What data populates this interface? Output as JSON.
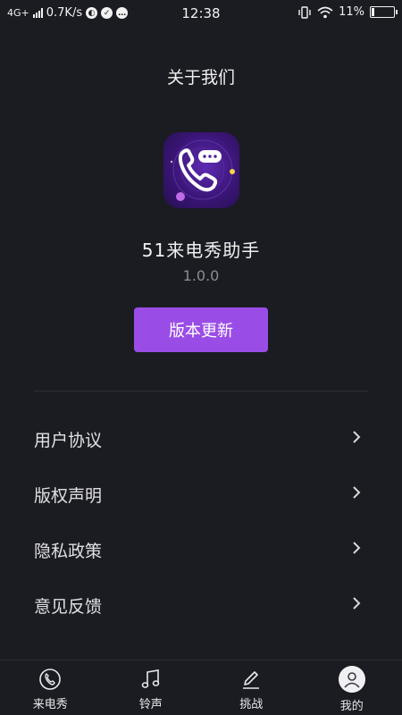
{
  "status_bar": {
    "network": "4G+",
    "speed": "0.7K/s",
    "time": "12:38",
    "battery_percent": "11%",
    "battery_level": 0.11
  },
  "header": {
    "title": "关于我们"
  },
  "app": {
    "name": "51来电秀助手",
    "version": "1.0.0",
    "update_label": "版本更新",
    "accent": "#9a4de6"
  },
  "menu": {
    "items": [
      {
        "label": "用户协议"
      },
      {
        "label": "版权声明"
      },
      {
        "label": "隐私政策"
      },
      {
        "label": "意见反馈"
      }
    ]
  },
  "bottom_nav": {
    "items": [
      {
        "label": "来电秀",
        "icon": "call-show-icon"
      },
      {
        "label": "铃声",
        "icon": "music-note-icon"
      },
      {
        "label": "挑战",
        "icon": "pen-icon"
      },
      {
        "label": "我的",
        "icon": "avatar-icon"
      }
    ]
  }
}
